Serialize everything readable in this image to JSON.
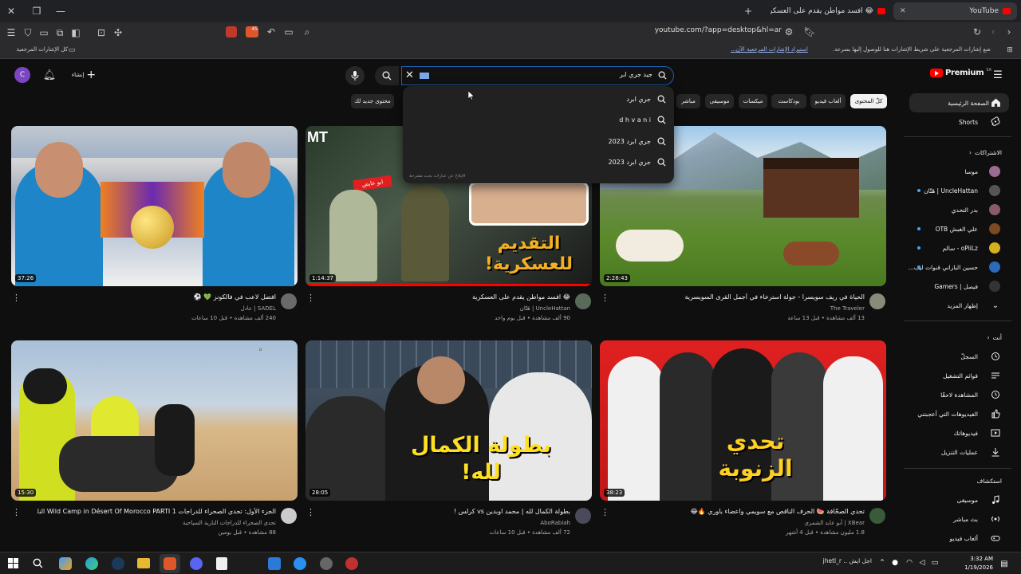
{
  "browser": {
    "tabs": [
      {
        "title": "YouTube",
        "active": true
      },
      {
        "title": "😂 افسد مواطن يقدم على العسكرية",
        "active": false
      }
    ],
    "url": "youtube.com/?app=desktop&hl=ar",
    "zoom_badge": "45",
    "bookmarks_hint": "ضع إشارات المرجعية على شريط الإشارات هنا للوصول إليها بسرعة.",
    "bookmarks_import": "استيراد الإشارات المرجعية الآن...",
    "all_bookmarks": "كل الإشارات المرجعية"
  },
  "header": {
    "logo": "Premium",
    "logo_sup": "SA",
    "create_label": "إنشاء",
    "avatar_letter": "C",
    "search_value": "جيد جري ابر",
    "search_selected": "•••"
  },
  "suggestions": [
    "جري ابرد",
    "d h v a n i",
    "جري ابرد 2023",
    "جري ابرد 2023"
  ],
  "suggestions_footer": "الإبلاغ عن عبارات بحث مقترحة",
  "chips": [
    "كلّ المحتوى",
    "ألعاب فيديو",
    "بودكاست",
    "ميكسات",
    "موسيقى",
    "مباشر",
    "محتوى جديد لك"
  ],
  "sidebar": {
    "main": [
      {
        "label": "الصفحة الرئيسية",
        "icon": "home-icon"
      },
      {
        "label": "Shorts",
        "icon": "shorts-icon"
      }
    ],
    "subs_header": "الاشتراكات",
    "subs": [
      {
        "label": "موسا",
        "color": "#9c6b8f",
        "dot": false
      },
      {
        "label": "UncleHattan | هَتّان",
        "color": "#555555",
        "dot": true
      },
      {
        "label": "بدر التحدي",
        "color": "#8a5a6a",
        "dot": false
      },
      {
        "label": "علي الغبش OTB",
        "color": "#7a4a20",
        "dot": true
      },
      {
        "label": "oPiiLz - سالم",
        "color": "#d4b020",
        "dot": true
      },
      {
        "label": "حسين البازاني قنوات ليب...",
        "color": "#2a6ab8",
        "dot": true
      },
      {
        "label": "فيصل | Gamers",
        "color": "#333333",
        "dot": false
      }
    ],
    "show_more": "إظهار المزيد",
    "you_header": "أنت",
    "you": [
      {
        "label": "السجلّ",
        "icon": "history-icon"
      },
      {
        "label": "قوائم التشغيل",
        "icon": "playlist-icon"
      },
      {
        "label": "المشاهدة لاحقًا",
        "icon": "clock-icon"
      },
      {
        "label": "الفيديوهات التي أعجبتني",
        "icon": "like-icon"
      },
      {
        "label": "فيديوهاتك",
        "icon": "video-icon"
      },
      {
        "label": "عمليات التنزيل",
        "icon": "download-icon"
      }
    ],
    "explore_header": "استكشاف",
    "explore": [
      {
        "label": "موسيقى",
        "icon": "music-icon"
      },
      {
        "label": "بث مباشر",
        "icon": "live-icon"
      },
      {
        "label": "ألعاب فيديو",
        "icon": "gaming-icon"
      }
    ]
  },
  "videos": [
    {
      "title": "الحياة في ريف سويسرا - جولة استرخاء في أجمل القرى السويسرية",
      "channel": "The Traveler",
      "meta": "13 ألف مشاهدة • قبل 13 ساعة",
      "duration": "2:28:43",
      "avatar_color": "#8a8a7a"
    },
    {
      "title": "😂 افسد مواطن يقدم على العسكرية",
      "channel": "UncleHattan | هَتّان",
      "meta": "90 ألف مشاهدة • قبل يوم واحد",
      "duration": "1:14:37",
      "avatar_color": "#5a6a5a"
    },
    {
      "title": "افضل لاعب في فالكونز 💚 ⚽",
      "channel": "SADEL | عادل",
      "meta": "240 ألف مشاهدة • قبل 10 ساعات",
      "duration": "37:26",
      "avatar_color": "#6a6a6a"
    },
    {
      "title": "تحدي الصحّافة 🍉 الحرف الناقص مع سويمي واعضاء باوري 🔥😂",
      "channel": "XBear | أبو عابد الشمري",
      "meta": "1.8 مليون مشاهدة • قبل 4 أشهر",
      "duration": "38:23",
      "avatar_color": "#3a5a3a"
    },
    {
      "title": "بطولة الكمال لله | محمد اوبدين vs كرلس !",
      "channel": "AboRabiah",
      "meta": "72 ألف مشاهدة • قبل 10 ساعات",
      "duration": "28:05",
      "avatar_color": "#4a4a5a"
    },
    {
      "title": "الجزء الأول: تحدي الصحراء للدراجات Wild Camp in Désert Of Morocco PARTI 1 النارية السياحية",
      "channel": "تحدي الصحراء للدراجات النارية السياحية",
      "meta": "88 مشاهدة • قبل يومين",
      "duration": "15:30",
      "avatar_color": "#cccccc"
    }
  ],
  "taskbar": {
    "time": "3:32 AM",
    "date": "1/19/2026",
    "notify_text": "اجل ايش .. jhetl_r"
  },
  "colors": {
    "youtube_red": "#ff0000",
    "bg": "#0f0f0f",
    "chip_active_bg": "#f1f1f1"
  }
}
